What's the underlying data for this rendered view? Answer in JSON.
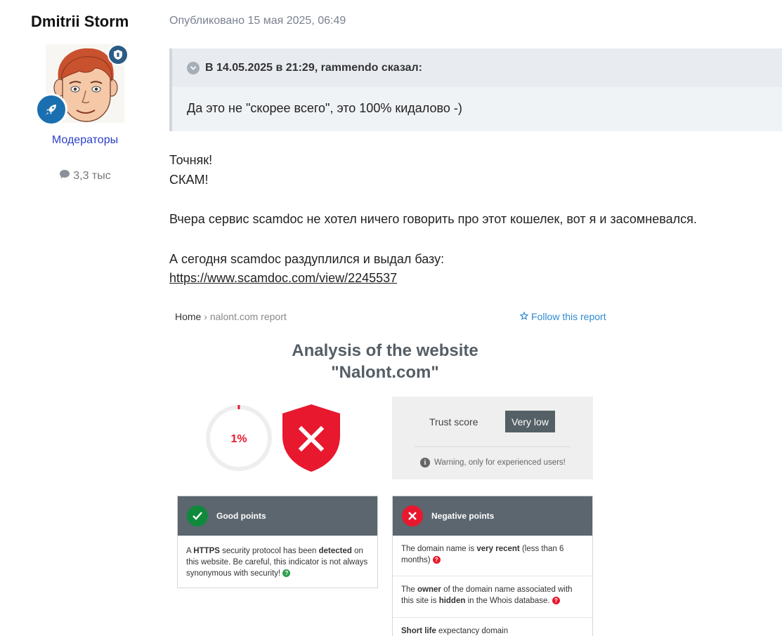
{
  "author": {
    "name": "Dmitrii Storm",
    "group": "Модераторы",
    "post_count": "3,3 тыс"
  },
  "post": {
    "date": "Опубликовано 15 мая 2025, 06:49",
    "quote": {
      "header": "В 14.05.2025 в 21:29, rammendo сказал:",
      "text": "Да это не \"скорее всего\", это 100% кидалово -)"
    },
    "lines": {
      "l1": "Точняк!",
      "l2": "СКАМ!",
      "l3": "Вчера сервис scamdoc не хотел ничего говорить про этот кошелек, вот я и засомневался.",
      "l4": "А сегодня scamdoc раздуплился и выдал базу:",
      "link": "https://www.scamdoc.com/view/2245537"
    }
  },
  "screenshot": {
    "breadcrumb": {
      "home": "Home",
      "sep": "›",
      "current": "nalont.com report"
    },
    "follow": "Follow this report",
    "title_line1": "Analysis of the website",
    "title_line2": "\"Nalont.com\"",
    "score": {
      "label": "1%",
      "value_percent": 1
    },
    "trust": {
      "label": "Trust score",
      "value": "Very low",
      "warning": "Warning, only for experienced users!"
    },
    "good": {
      "title": "Good points",
      "item": {
        "p1": "A ",
        "b1": "HTTPS",
        "p2": " security protocol has been ",
        "b2": "detected",
        "p3": " on this website. Be careful, this indicator is not always synonymous with security!"
      }
    },
    "negative": {
      "title": "Negative points",
      "item1": {
        "p1": "The domain name is ",
        "b1": "very recent",
        "p2": " (less than 6 months)"
      },
      "item2": {
        "p1": "The ",
        "b1": "owner",
        "p2": " of the domain name associated with this site is ",
        "b2": "hidden",
        "p3": " in the Whois database."
      },
      "item3": {
        "b1": "Short life",
        "p1": " expectancy domain"
      }
    },
    "colors": {
      "danger": "#e8182e",
      "good": "#0f8a3c",
      "panel_header": "#5b666f",
      "link": "#2f8ad1"
    }
  }
}
